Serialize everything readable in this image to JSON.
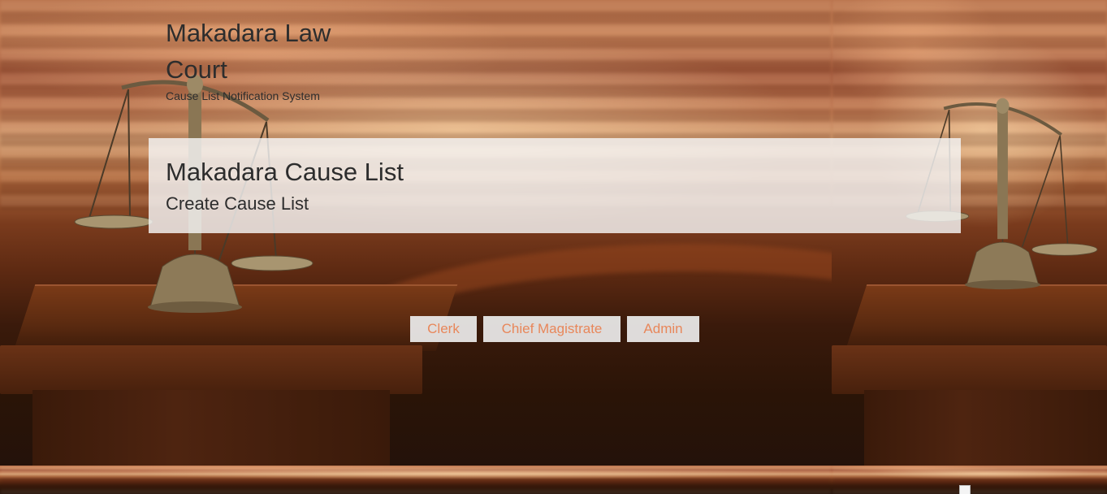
{
  "header": {
    "site_title": "Makadara Law Court",
    "tagline": "Cause List Notification System"
  },
  "banner": {
    "title": "Makadara Cause List",
    "subtitle": "Create Cause List"
  },
  "roles": {
    "clerk": "Clerk",
    "chief_magistrate": "Chief Magistrate",
    "admin": "Admin"
  },
  "icons": {
    "scales": "scales-of-justice-icon",
    "broken_image": "broken-image-icon"
  },
  "colors": {
    "button_text": "#e8875a",
    "banner_background": "#f5f5f5",
    "heading_text": "#2d2d2d"
  }
}
